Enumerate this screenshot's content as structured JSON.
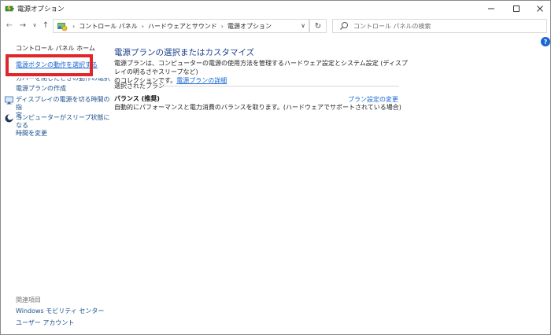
{
  "window": {
    "title": "電源オプション"
  },
  "nav": {
    "breadcrumbs": [
      "コントロール パネル",
      "ハードウェアとサウンド",
      "電源オプション"
    ],
    "search_placeholder": "コントロール パネルの検索"
  },
  "left_pane": {
    "home": "コントロール パネル ホーム",
    "links": [
      "電源ボタンの動作を選択する",
      "カバーを閉じたときの動作の選択",
      "電源プランの作成",
      "ディスプレイの電源を切る時間の指定",
      "コンピューターがスリープ状態になる時間を変更"
    ],
    "link_lines": {
      "display": [
        "ディスプレイの電源を切る時間の指",
        "定"
      ],
      "sleep": [
        "コンピューターがスリープ状態になる",
        "時間を変更"
      ]
    },
    "related_heading": "関連項目",
    "related": [
      "Windows モビリティ センター",
      "ユーザー アカウント"
    ]
  },
  "main": {
    "title": "電源プランの選択またはカスタマイズ",
    "desc_line1": "電源プランは、コンピューターの電源の使用方法を管理するハードウェア設定とシステム設定 (ディスプレイの明るさやスリープなど)",
    "desc_line2": "のコレクションです。",
    "desc_link": "電源プランの詳細",
    "group_label": "選択されたプラン",
    "plan_name": "バランス (推奨)",
    "plan_desc": "自動的にパフォーマンスと電力消費のバランスを取ります。(ハードウェアでサポートされている場合)",
    "plan_change": "プラン設定の変更"
  },
  "colors": {
    "highlight": "#e0262b",
    "link": "#1a66d2",
    "title": "#1a3f8a"
  }
}
